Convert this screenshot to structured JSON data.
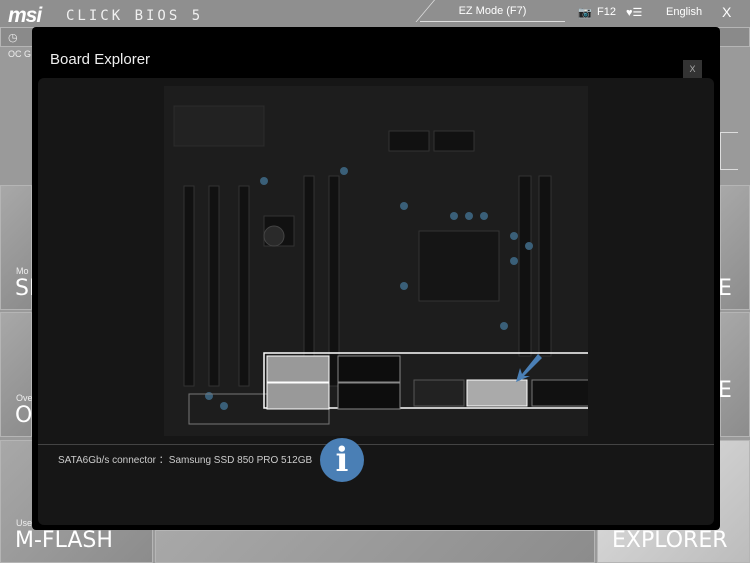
{
  "header": {
    "brand": "msi",
    "product": "CLICK BIOS 5",
    "ez_mode": "EZ Mode (F7)",
    "screenshot_key": "F12",
    "language": "English",
    "close": "X"
  },
  "background_tiles": {
    "oc_label": "OC G",
    "tile1_small": "Mo",
    "tile1_big": "SI",
    "tile2_small": "Ove",
    "tile2_big": "O",
    "mflash_small": "Use",
    "mflash_big": "M-FLASH",
    "right1": "E",
    "right2": "E",
    "explorer": "EXPLORER"
  },
  "modal": {
    "title": "Board Explorer",
    "close_label": "X",
    "info_text": "SATA6Gb/s connector ：Samsung SSD 850 PRO 512GB",
    "info_icon": "info-icon",
    "highlight_color": "#4a7fb5"
  }
}
